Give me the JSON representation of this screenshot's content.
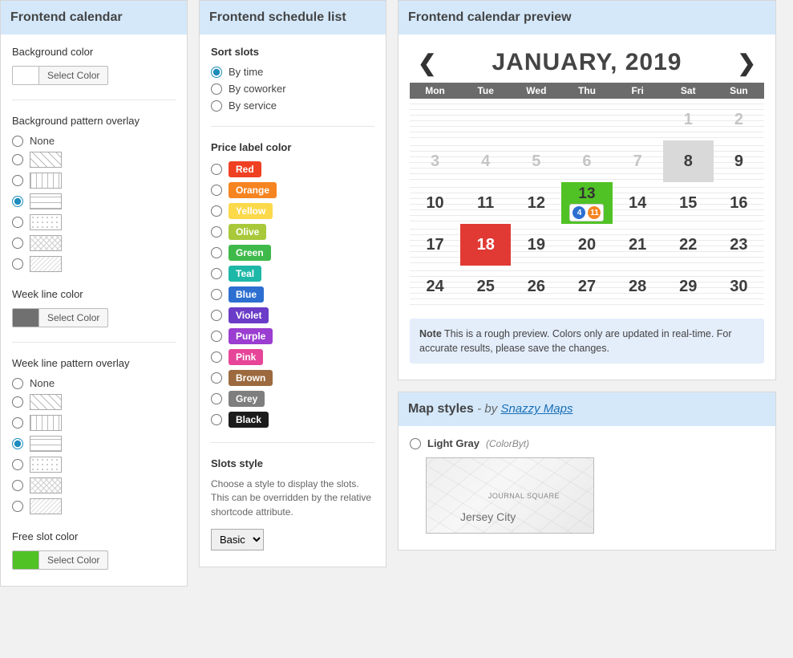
{
  "panels": {
    "cal": {
      "title": "Frontend calendar"
    },
    "list": {
      "title": "Frontend schedule list"
    },
    "preview": {
      "title": "Frontend calendar preview"
    },
    "maps": {
      "title": "Map styles",
      "by": "- by ",
      "link": "Snazzy Maps"
    }
  },
  "calendar": {
    "bg_color_label": "Background color",
    "select_color": "Select Color",
    "bg_pattern_label": "Background pattern overlay",
    "none": "None",
    "week_line_color_label": "Week line color",
    "week_line_pattern_label": "Week line pattern overlay",
    "free_slot_label": "Free slot color"
  },
  "list": {
    "sort_label": "Sort slots",
    "sort_options": {
      "time": "By time",
      "coworker": "By coworker",
      "service": "By service"
    },
    "price_label": "Price label color",
    "colors": [
      {
        "name": "Red",
        "hex": "#ef4023"
      },
      {
        "name": "Orange",
        "hex": "#f68420"
      },
      {
        "name": "Yellow",
        "hex": "#fcd94a",
        "fg": "#fff"
      },
      {
        "name": "Olive",
        "hex": "#a9c93b"
      },
      {
        "name": "Green",
        "hex": "#3fba4a"
      },
      {
        "name": "Teal",
        "hex": "#1eb8a8"
      },
      {
        "name": "Blue",
        "hex": "#2d6fd1"
      },
      {
        "name": "Violet",
        "hex": "#6a3cc7"
      },
      {
        "name": "Purple",
        "hex": "#9a3dd0"
      },
      {
        "name": "Pink",
        "hex": "#e64598"
      },
      {
        "name": "Brown",
        "hex": "#9c6a3e"
      },
      {
        "name": "Grey",
        "hex": "#7e7e7e"
      },
      {
        "name": "Black",
        "hex": "#1b1b1b"
      }
    ],
    "slots_style_label": "Slots style",
    "slots_style_desc": "Choose a style to display the slots. This can be overridden by the relative shortcode attribute.",
    "slots_style_value": "Basic"
  },
  "preview": {
    "month": "JANUARY, 2019",
    "days": [
      "Mon",
      "Tue",
      "Wed",
      "Thu",
      "Fri",
      "Sat",
      "Sun"
    ],
    "weeks": [
      [
        "",
        "",
        "",
        "",
        "",
        "1",
        "2"
      ],
      [
        "3",
        "4",
        "5",
        "6",
        "7",
        "8",
        "9"
      ],
      [
        "10",
        "11",
        "12",
        "13",
        "14",
        "15",
        "16"
      ],
      [
        "17",
        "18",
        "19",
        "20",
        "21",
        "22",
        "23"
      ],
      [
        "24",
        "25",
        "26",
        "27",
        "28",
        "29",
        "30"
      ]
    ],
    "circles": {
      "a": "4",
      "b": "11"
    },
    "note_label": "Note",
    "note_text": "This is a rough preview. Colors only are updated in real-time. For accurate results, please save the changes."
  },
  "maps": {
    "option_label": "Light Gray",
    "option_author": "(ColorByt)",
    "city": "Jersey City",
    "district": "JOURNAL SQUARE"
  }
}
